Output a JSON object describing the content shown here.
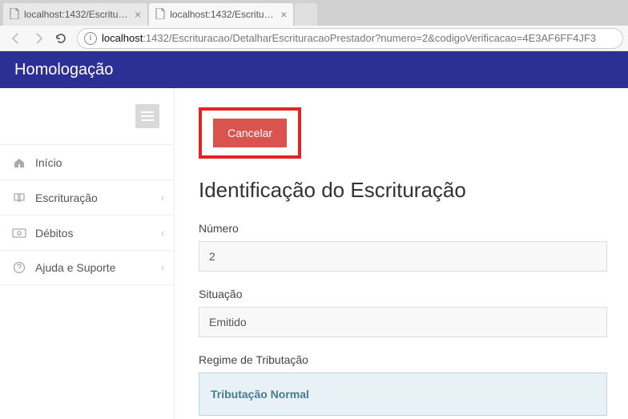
{
  "browser": {
    "tabs": [
      {
        "title": "localhost:1432/Escriturac"
      },
      {
        "title": "localhost:1432/Escriturac"
      }
    ],
    "url_host": "localhost",
    "url_path": ":1432/Escrituracao/DetalharEscrituracaoPrestador?numero=2&codigoVerificacao=4E3AF6FF4JF3"
  },
  "header": {
    "title": "Homologação"
  },
  "sidebar": {
    "items": [
      {
        "label": "Início",
        "has_sub": false
      },
      {
        "label": "Escrituração",
        "has_sub": true
      },
      {
        "label": "Débitos",
        "has_sub": true
      },
      {
        "label": "Ajuda e Suporte",
        "has_sub": true
      }
    ]
  },
  "actions": {
    "cancel_label": "Cancelar"
  },
  "page": {
    "title": "Identificação do Escrituração",
    "fields": {
      "numero": {
        "label": "Número",
        "value": "2"
      },
      "situacao": {
        "label": "Situação",
        "value": "Emitido"
      },
      "regime": {
        "label": "Regime de Tributação",
        "value": "Tributação Normal"
      }
    }
  }
}
